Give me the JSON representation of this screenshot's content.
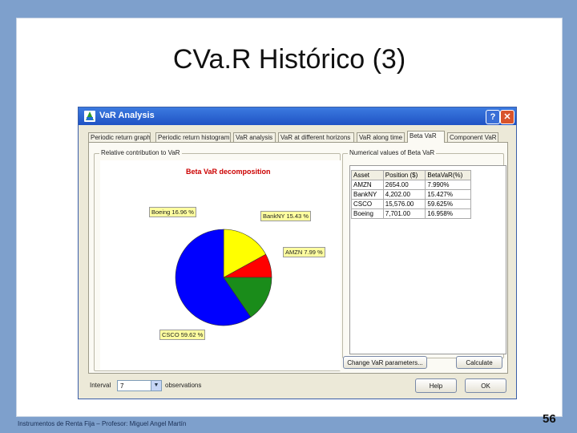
{
  "slide": {
    "title": "CVa.R Histórico (3)",
    "footer": "Instrumentos de Renta Fija – Profesor: Miguel Angel Martín",
    "page_number": "56"
  },
  "window": {
    "title": "VaR Analysis",
    "help_label": "?",
    "close_label": "✕",
    "app_icon": "pyramid-icon"
  },
  "tabs": [
    "Periodic return graph",
    "Periodic return histogram",
    "VaR analysis",
    "VaR at different horizons",
    "VaR along time",
    "Beta VaR",
    "Component VaR"
  ],
  "active_tab": "Beta VaR",
  "left_group": {
    "label": "Relative contribution to VaR"
  },
  "right_group": {
    "label": "Numerical values of Beta VaR"
  },
  "chart_data": {
    "type": "pie",
    "title": "Beta VaR decomposition",
    "slices": [
      {
        "name": "AMZN",
        "label": "AMZN 7.99 %",
        "value": 7.99,
        "color": "#ff0000"
      },
      {
        "name": "Boeing",
        "label": "Boeing 16.96 %",
        "value": 16.96,
        "color": "#ffff00"
      },
      {
        "name": "CSCO",
        "label": "CSCO 59.62 %",
        "value": 59.62,
        "color": "#0000ff"
      },
      {
        "name": "BankNY",
        "label": "BankNY 15.43 %",
        "value": 15.43,
        "color": "#1a8c1a"
      }
    ]
  },
  "table": {
    "headers": [
      "Asset",
      "Position ($)",
      "BetaVaR(%)"
    ],
    "rows": [
      [
        "AMZN",
        "2654.00",
        "7.990%"
      ],
      [
        "BankNY",
        "4,202.00",
        "15.427%"
      ],
      [
        "CSCO",
        "15,576.00",
        "59.625%"
      ],
      [
        "Boeing",
        "7,701.00",
        "16.958%"
      ]
    ]
  },
  "buttons": {
    "change_params": "Change VaR parameters...",
    "calculate": "Calculate",
    "help": "Help",
    "ok": "OK"
  },
  "interval": {
    "label": "Interval",
    "value": "7",
    "suffix": "observations"
  }
}
